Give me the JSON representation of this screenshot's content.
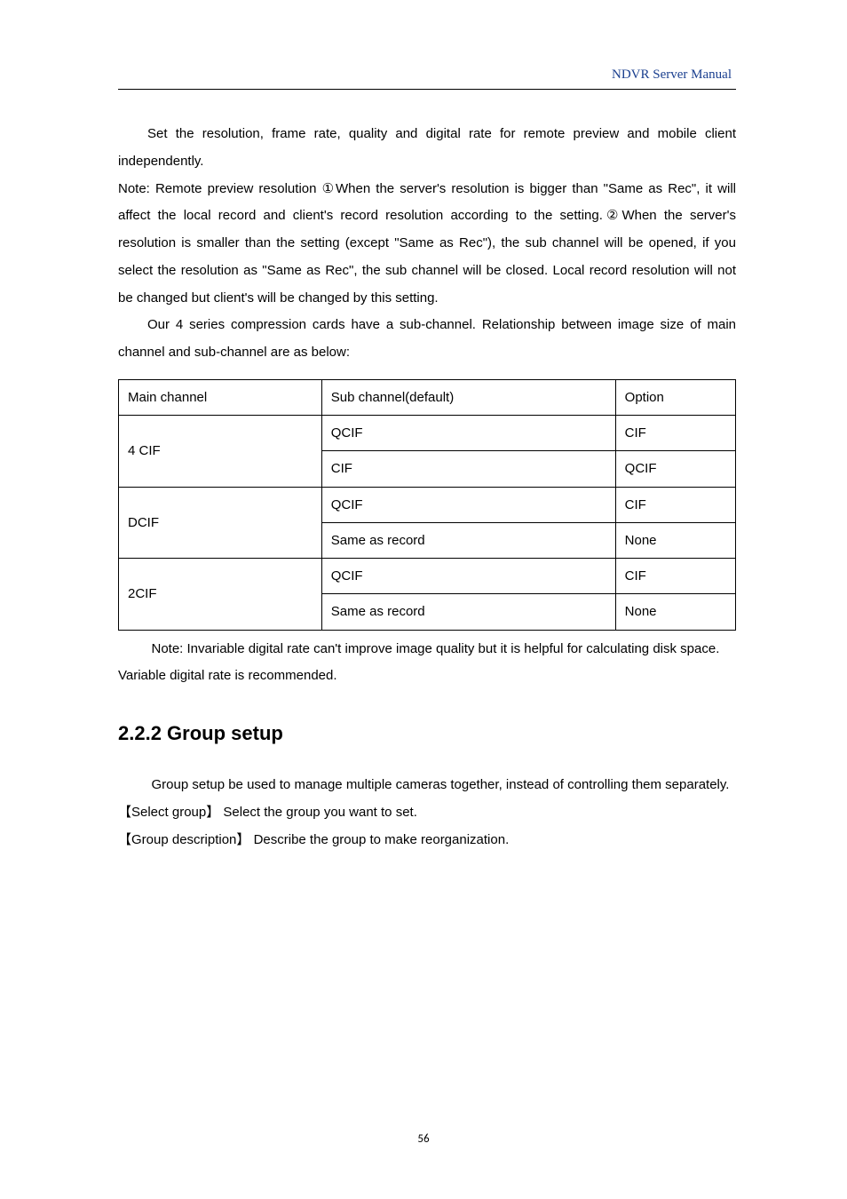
{
  "header": {
    "running_title": "NDVR Server Manual"
  },
  "body": {
    "para1": "Set the resolution, frame rate, quality and digital rate for remote preview and mobile client independently.",
    "para2_prefix": "Note: Remote preview resolution",
    "para2_body": "①When the server's resolution is bigger than \"Same as Rec\", it will affect the local record and client's record resolution according to the setting.②When the server's resolution is smaller than the setting (except \"Same as Rec\"), the sub channel will be opened, if you select the resolution as \"Same as Rec\", the sub channel will be closed. Local record resolution will not be changed but client's will be changed by this setting.",
    "para3": "Our 4 series compression cards have a sub-channel. Relationship between image size of main channel and sub-channel are as below:",
    "note_text": "Note: Invariable digital rate can't improve image quality but it is helpful for calculating disk space. Variable digital rate is recommended.",
    "section_heading": "2.2.2 Group setup",
    "group_intro": "Group setup be used to manage multiple cameras together, instead of controlling them separately.",
    "def1_label": "【Select group】",
    "def1_body": "Select the group you want to set.",
    "def2_label": "【Group description】",
    "def2_body": "Describe the group to make reorganization."
  },
  "table": {
    "headers": {
      "col1": "Main channel",
      "col2": "Sub channel(default)",
      "col3": "Option"
    },
    "rows": [
      {
        "main": "4 CIF",
        "sub": "QCIF",
        "opt": "CIF"
      },
      {
        "main": "4 CIF",
        "sub_alt": "CIF",
        "opt_alt": "QCIF"
      },
      {
        "main": "DCIF",
        "sub": "QCIF",
        "opt": "CIF"
      },
      {
        "main": "DCIF",
        "sub_alt": "Same as record",
        "opt_alt": "None"
      },
      {
        "main": "2CIF",
        "sub": "QCIF",
        "opt": "CIF"
      },
      {
        "main": "2CIF",
        "sub_alt": "Same as record",
        "opt_alt": "None"
      }
    ]
  },
  "footer": {
    "page_number": "56"
  }
}
